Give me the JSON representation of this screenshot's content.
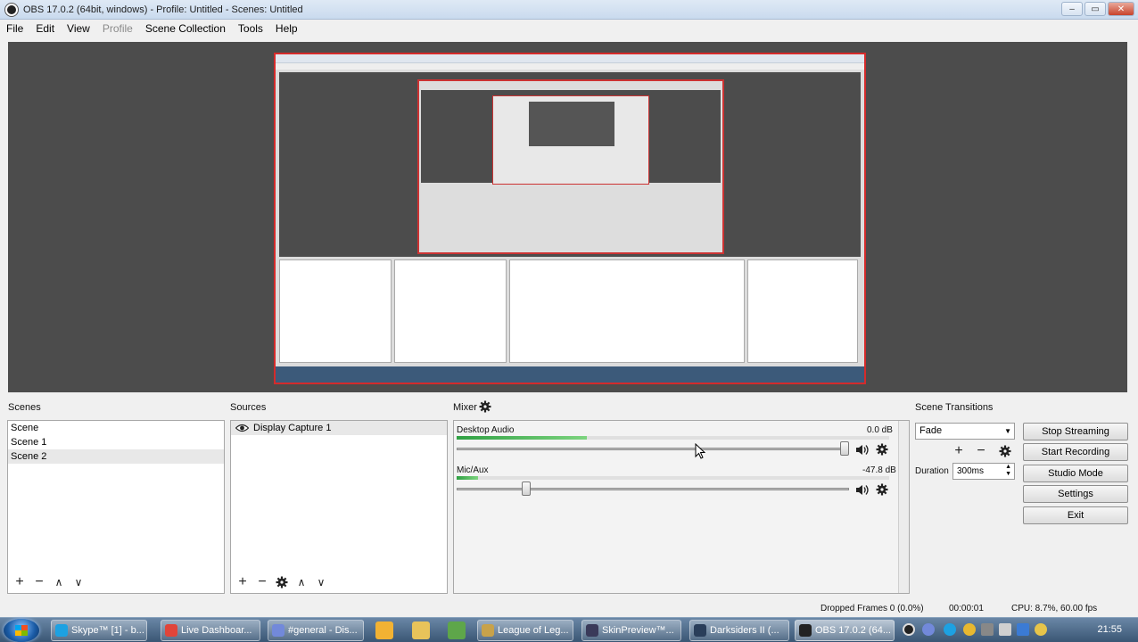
{
  "window": {
    "title": "OBS 17.0.2 (64bit, windows) - Profile: Untitled - Scenes: Untitled",
    "controls": [
      "–",
      "▭",
      "✕"
    ]
  },
  "menu": {
    "items": [
      "File",
      "Edit",
      "View",
      "Profile",
      "Scene Collection",
      "Tools",
      "Help"
    ],
    "disabled": [
      "Profile"
    ]
  },
  "scenes": {
    "label": "Scenes",
    "items": [
      "Scene",
      "Scene 1",
      "Scene 2"
    ],
    "selected_index": 2,
    "toolbar": [
      "+",
      "−",
      "∧",
      "∨"
    ]
  },
  "sources": {
    "label": "Sources",
    "items": [
      {
        "name": "Display Capture 1",
        "visible": true
      }
    ],
    "toolbar": [
      "+",
      "−",
      "gear",
      "∧",
      "∨"
    ]
  },
  "mixer": {
    "label": "Mixer",
    "tracks": [
      {
        "name": "Desktop Audio",
        "db": "0.0 dB",
        "meter_level": 0.3,
        "volume": 1.0
      },
      {
        "name": "Mic/Aux",
        "db": "-47.8 dB",
        "meter_level": 0.05,
        "volume": 0.17
      }
    ]
  },
  "transitions": {
    "label": "Scene Transitions",
    "selected": "Fade",
    "duration_label": "Duration",
    "duration_value": "300ms"
  },
  "controls": {
    "buttons": [
      "Stop Streaming",
      "Start Recording",
      "Studio Mode",
      "Settings",
      "Exit"
    ]
  },
  "status": {
    "dropped_frames": "Dropped Frames 0 (0.0%)",
    "time": "00:00:01",
    "cpu": "CPU: 8.7%, 60.00 fps"
  },
  "taskbar": {
    "tasks": [
      {
        "label": "Skype™ [1] - b...",
        "color": "#1da1e2"
      },
      {
        "label": "Live Dashboar...",
        "color": "#e0453a"
      },
      {
        "label": "#general - Dis...",
        "color": "#7289da"
      },
      {
        "label": "League of Leg...",
        "color": "#c8a24a"
      },
      {
        "label": "SkinPreview™...",
        "color": "#3a3a5a"
      },
      {
        "label": "Darksiders II (...",
        "color": "#2a3e5a"
      },
      {
        "label": "OBS 17.0.2 (64...",
        "color": "#222222"
      }
    ],
    "clock": "21:55"
  },
  "colors": {
    "preview_bg": "#4c4c4c",
    "source_border": "#d42b2b",
    "meter": "#2fa043"
  }
}
